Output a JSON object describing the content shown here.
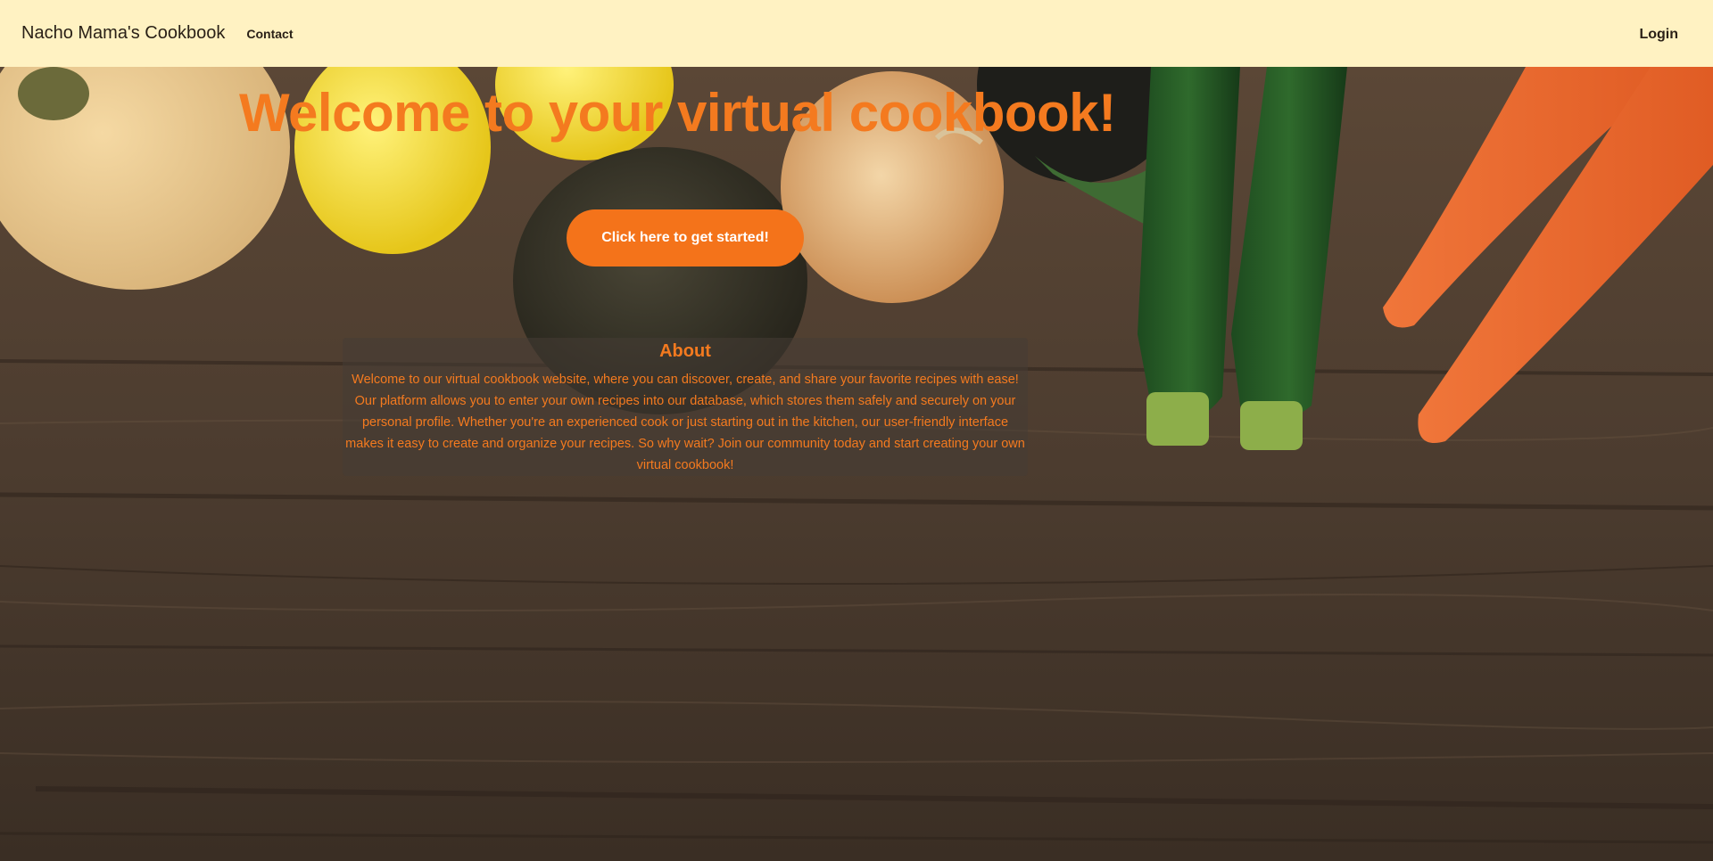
{
  "navbar": {
    "brand": "Nacho Mama's Cookbook",
    "contact_label": "Contact",
    "login_label": "Login"
  },
  "hero": {
    "headline": "Welcome to your virtual cookbook!",
    "cta_label": "Click here to get started!"
  },
  "about": {
    "title": "About",
    "body": "Welcome to our virtual cookbook website, where you can discover, create, and share your favorite recipes with ease! Our platform allows you to enter your own recipes into our database, which stores them safely and securely on your personal profile. Whether you're an experienced cook or just starting out in the kitchen, our user-friendly interface makes it easy to create and organize your recipes. So why wait? Join our community today and start creating your own virtual cookbook!"
  },
  "colors": {
    "navbar_bg": "#fff2c2",
    "accent": "#f47a1f",
    "button_bg": "#f4731a",
    "wood": "#4a3a2c"
  },
  "icons": {
    "background_image": "vegetables-on-wooden-table"
  }
}
